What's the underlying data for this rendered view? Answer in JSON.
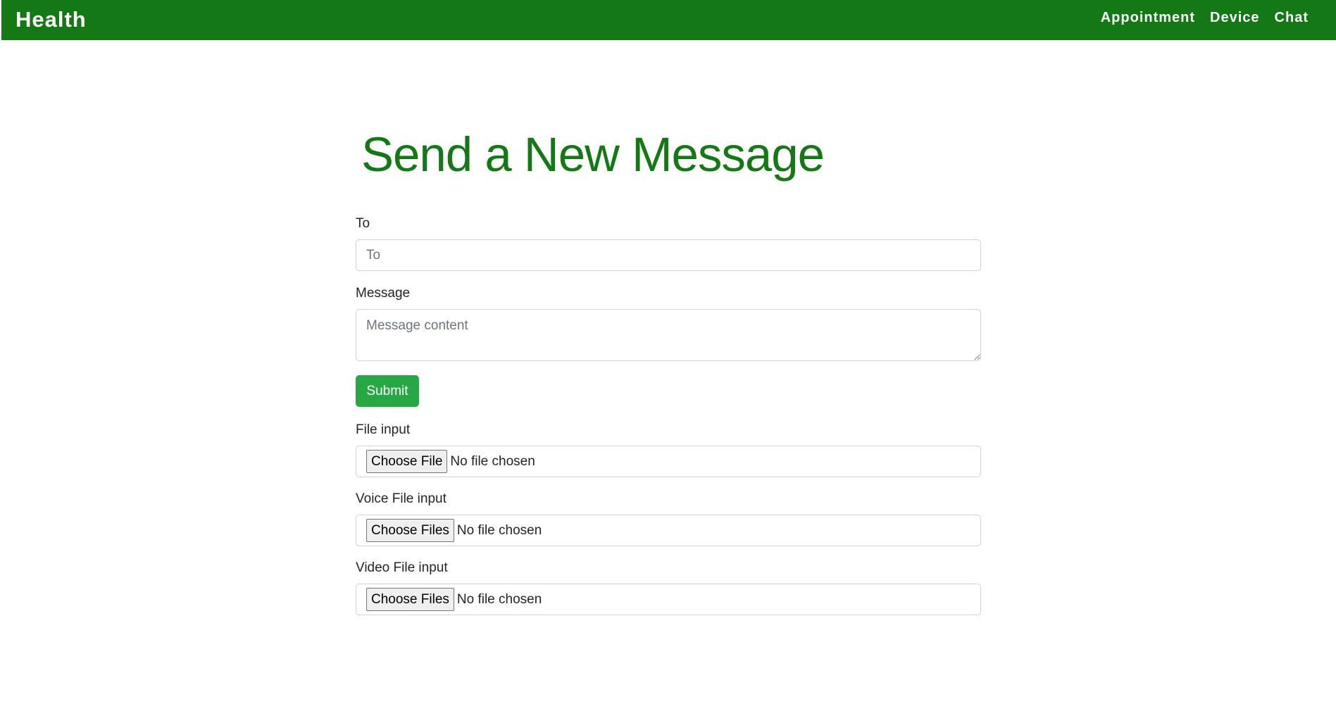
{
  "navbar": {
    "brand": "Health",
    "links": [
      "Appointment",
      "Device",
      "Chat"
    ]
  },
  "form": {
    "title": "Send a New Message",
    "to_label": "To",
    "to_placeholder": "To",
    "message_label": "Message",
    "message_placeholder": "Message content",
    "submit_label": "Submit",
    "file_inputs": [
      {
        "label": "File input",
        "button": "Choose File",
        "status": "No file chosen"
      },
      {
        "label": "Voice File input",
        "button": "Choose Files",
        "status": "No file chosen"
      },
      {
        "label": "Video File input",
        "button": "Choose Files",
        "status": "No file chosen"
      }
    ]
  },
  "colors": {
    "navbar_bg": "#147814",
    "title_color": "#147814",
    "submit_bg": "#28a745"
  }
}
